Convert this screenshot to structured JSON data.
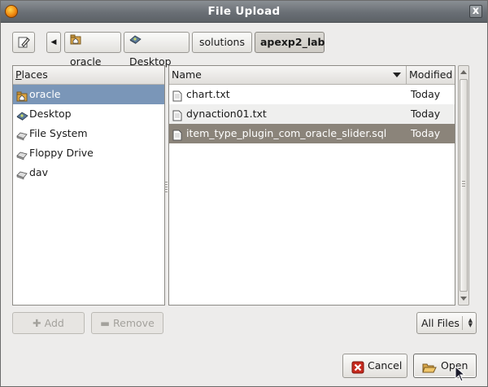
{
  "window": {
    "title": "File Upload",
    "close_glyph": "x"
  },
  "pathbar": {
    "back_glyph": "◀",
    "crumbs": [
      {
        "label": "oracle",
        "icon": "home-folder-icon"
      },
      {
        "label": "Desktop",
        "icon": "desktop-icon"
      },
      {
        "label": "solutions"
      },
      {
        "label": "apexp2_lab",
        "active": true
      }
    ]
  },
  "places": {
    "header": "Places",
    "items": [
      {
        "label": "oracle",
        "icon": "home-folder-icon",
        "selected": true
      },
      {
        "label": "Desktop",
        "icon": "desktop-icon"
      },
      {
        "label": "File System",
        "icon": "drive-icon"
      },
      {
        "label": "Floppy Drive",
        "icon": "floppy-icon"
      },
      {
        "label": "dav",
        "icon": "drive-icon"
      }
    ]
  },
  "files": {
    "columns": {
      "name": "Name",
      "modified": "Modified"
    },
    "rows": [
      {
        "name": "chart.txt",
        "modified": "Today",
        "icon": "text-file-icon"
      },
      {
        "name": "dynaction01.txt",
        "modified": "Today",
        "icon": "text-file-icon"
      },
      {
        "name": "item_type_plugin_com_oracle_slider.sql",
        "modified": "Today",
        "icon": "text-file-icon",
        "selected": true
      }
    ]
  },
  "buttons": {
    "add_label": "Add",
    "remove_label": "Remove",
    "filter_value": "All Files",
    "cancel_label": "Cancel",
    "open_label": "Open"
  },
  "colors": {
    "selection_places": "#7a96b8",
    "selection_files": "#8b847a",
    "titlebar": "#6a6f75"
  }
}
